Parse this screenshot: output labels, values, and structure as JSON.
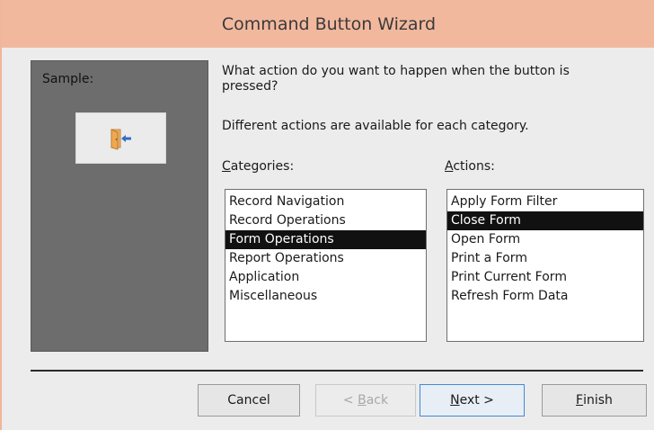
{
  "window": {
    "title": "Command Button Wizard"
  },
  "sample": {
    "label": "Sample:",
    "icon": "close-form-door-arrow-icon"
  },
  "prompt": {
    "question": "What action do you want to happen when the button is pressed?",
    "hint": "Different actions are available for each category."
  },
  "categories": {
    "heading_access_key": "C",
    "heading_rest": "ategories:",
    "items": [
      {
        "label": "Record Navigation",
        "selected": false
      },
      {
        "label": "Record Operations",
        "selected": false
      },
      {
        "label": "Form Operations",
        "selected": true
      },
      {
        "label": "Report Operations",
        "selected": false
      },
      {
        "label": "Application",
        "selected": false
      },
      {
        "label": "Miscellaneous",
        "selected": false
      }
    ]
  },
  "actions": {
    "heading_access_key": "A",
    "heading_rest": "ctions:",
    "items": [
      {
        "label": "Apply Form Filter",
        "selected": false
      },
      {
        "label": "Close Form",
        "selected": true
      },
      {
        "label": "Open Form",
        "selected": false
      },
      {
        "label": "Print a Form",
        "selected": false
      },
      {
        "label": "Print Current Form",
        "selected": false
      },
      {
        "label": "Refresh Form Data",
        "selected": false
      }
    ]
  },
  "buttons": {
    "cancel": {
      "label": "Cancel",
      "enabled": true
    },
    "back": {
      "prefix": "< ",
      "access_key": "B",
      "rest": "ack",
      "enabled": false
    },
    "next": {
      "access_key": "N",
      "rest": "ext >",
      "enabled": true,
      "default": true
    },
    "finish": {
      "access_key": "F",
      "rest": "inish",
      "enabled": true
    }
  },
  "colors": {
    "titlebar": "#f2b89e",
    "sample_panel": "#6d6d6d",
    "selection": "#111111",
    "default_button_border": "#3f8ad6"
  }
}
